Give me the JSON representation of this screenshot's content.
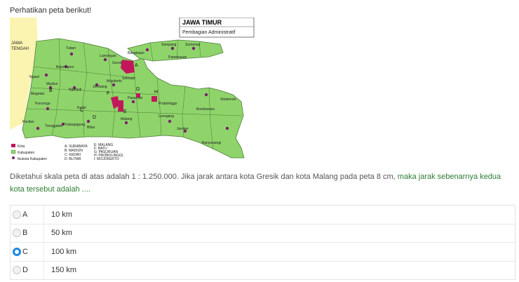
{
  "instruction": "Perhatikan peta berikut!",
  "map": {
    "title": "JAWA TIMUR",
    "subtitle": "Pembagian Administratif",
    "west_label_1": "JAWA",
    "west_label_2": "TENGAH",
    "region_labels": [
      "Tuban",
      "Lamongan",
      "Gresik",
      "Bojonegoro",
      "Ngawi",
      "Madiun",
      "Nganjuk",
      "Jombang",
      "Mojokerto",
      "Sidoarjo",
      "Pasuruan",
      "Probolinggo",
      "Situbondo",
      "Bondowoso",
      "Kediri",
      "Magetan",
      "Ponorogo",
      "Pacitan",
      "Trenggalek",
      "Tulungagung",
      "Blitar",
      "Malang",
      "Lumajang",
      "Jember",
      "Banyuwangi",
      "Bangkalan",
      "Sampang",
      "Sumenep",
      "Pamekasan"
    ],
    "markers": [
      "A",
      "B",
      "C",
      "D",
      "E",
      "F",
      "G",
      "H"
    ],
    "legend": {
      "kota": "Kota",
      "kabupaten": "Kabupaten",
      "ibukota": "Ibukota Kabupaten",
      "cities_col1": [
        "A: SURABAYA",
        "B: MADIUN",
        "C: KEDIRI",
        "D: BLITAR"
      ],
      "cities_col2": [
        "E: MALANG",
        "F: BATU",
        "G: PASURUAN",
        "H: PROBOLINGGI",
        "I: MOJOKERTO"
      ]
    },
    "colors": {
      "kabupaten": "#8fd46b",
      "kota": "#c2185b",
      "jateng": "#fbf3b0",
      "sea": "#ffffff"
    }
  },
  "question": {
    "part1": "Diketahui skala peta di atas adalah 1 : 1.250.000. Jika jarak antara kota Gresik dan kota Malang pada peta 8 cm, ",
    "part2": "maka jarak sebenarnya kedua kota tersebut adalah ...."
  },
  "options": [
    {
      "letter": "A",
      "value": "10 km",
      "selected": false
    },
    {
      "letter": "B",
      "value": "50 km",
      "selected": false
    },
    {
      "letter": "C",
      "value": "100 km",
      "selected": true
    },
    {
      "letter": "D",
      "value": "150 km",
      "selected": false
    }
  ]
}
